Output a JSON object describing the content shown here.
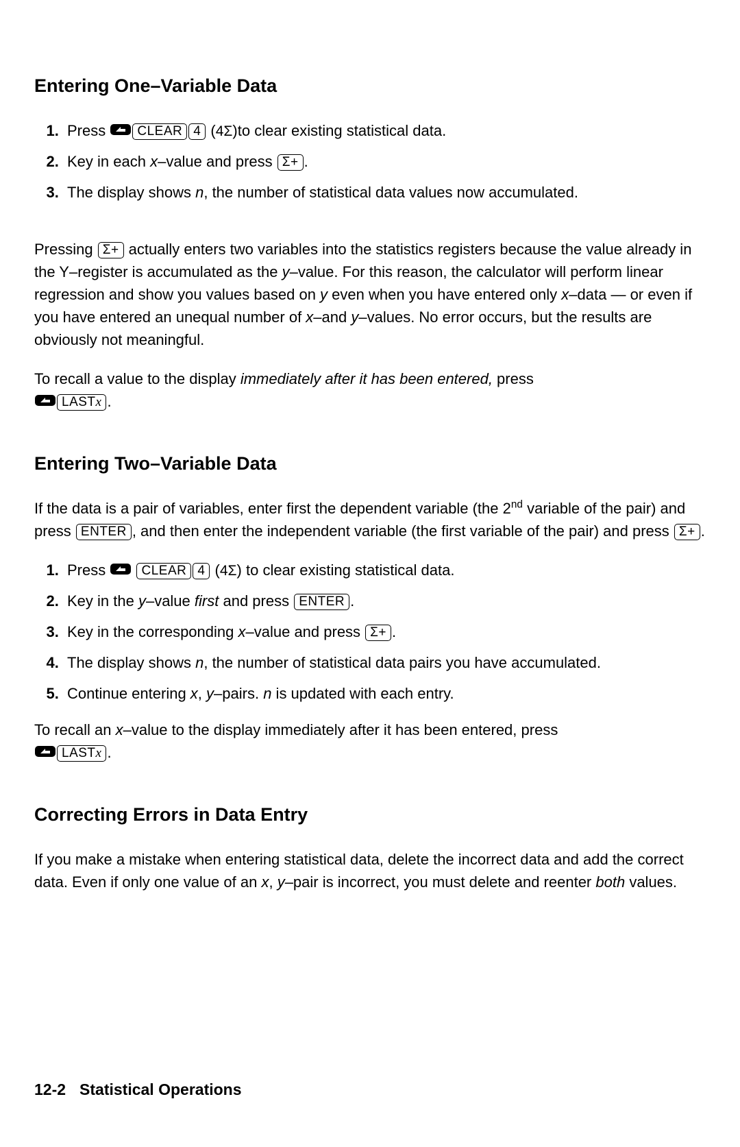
{
  "keys": {
    "clear": "CLEAR",
    "four": "4",
    "sigma_plus": "Σ+",
    "enter": "ENTER",
    "lastx": "LAST"
  },
  "section1": {
    "heading": "Entering One–Variable Data",
    "step1_a": "Press ",
    "step1_paren": "4Σ",
    "step1_b": "to clear existing statistical data.",
    "step2_a": "Key in each ",
    "step2_x": "x",
    "step2_b": "–value and press ",
    "step3_a": "The display shows ",
    "step3_n": "n",
    "step3_b": ", the number of statistical data values now accumulated.",
    "para1_a": "Pressing ",
    "para1_b": " actually enters two variables into the statistics registers because the value already in the Y–register is accumulated as the ",
    "para1_y": "y",
    "para1_c": "–value. For this reason, the calculator will perform linear regression and show you values based on ",
    "para1_y2": "y",
    "para1_d": " even when you have entered only ",
    "para1_x": "x",
    "para1_e": "–data — or even if you have entered an unequal number of ",
    "para1_x2": "x",
    "para1_f": "–and ",
    "para1_y3": "y",
    "para1_g": "–values. No error occurs, but the results are obviously not meaningful.",
    "para2_a": "To recall a value to the display ",
    "para2_i": "immediately after it has been entered,",
    "para2_b": " press "
  },
  "section2": {
    "heading": "Entering Two–Variable Data",
    "intro_a": "If the data is a pair of variables, enter first the dependent variable (the 2",
    "intro_sup": "nd",
    "intro_b": " variable of the pair) and press ",
    "intro_c": ", and then enter the independent variable (the first variable of the pair) and press ",
    "step1_a": "Press ",
    "step1_paren": "4Σ",
    "step1_b": " to clear existing statistical data.",
    "step2_a": "Key in the ",
    "step2_y": "y",
    "step2_b": "–value ",
    "step2_first": "first",
    "step2_c": " and press ",
    "step3_a": "Key in the corresponding ",
    "step3_x": "x",
    "step3_b": "–value and press ",
    "step4_a": "The display shows ",
    "step4_n": "n",
    "step4_b": ", the number of statistical data pairs you have accumulated.",
    "step5_a": "Continue entering ",
    "step5_x": "x",
    "step5_c1": ", ",
    "step5_y": "y",
    "step5_b": "–pairs. ",
    "step5_n": "n",
    "step5_c": " is updated with each entry.",
    "para_a": "To recall an ",
    "para_x": "x",
    "para_b": "–value to the display immediately after it has been entered, press "
  },
  "section3": {
    "heading": "Correcting Errors in Data Entry",
    "para_a": "If you make a mistake when entering statistical data, delete the incorrect data and add the correct data. Even if only one value of an ",
    "para_x": "x",
    "para_c": ", ",
    "para_y": "y",
    "para_b": "–pair is incorrect, you must delete and reenter ",
    "para_both": "both",
    "para_d": " values."
  },
  "footer": {
    "page": "12-2",
    "chapter": "Statistical Operations"
  }
}
